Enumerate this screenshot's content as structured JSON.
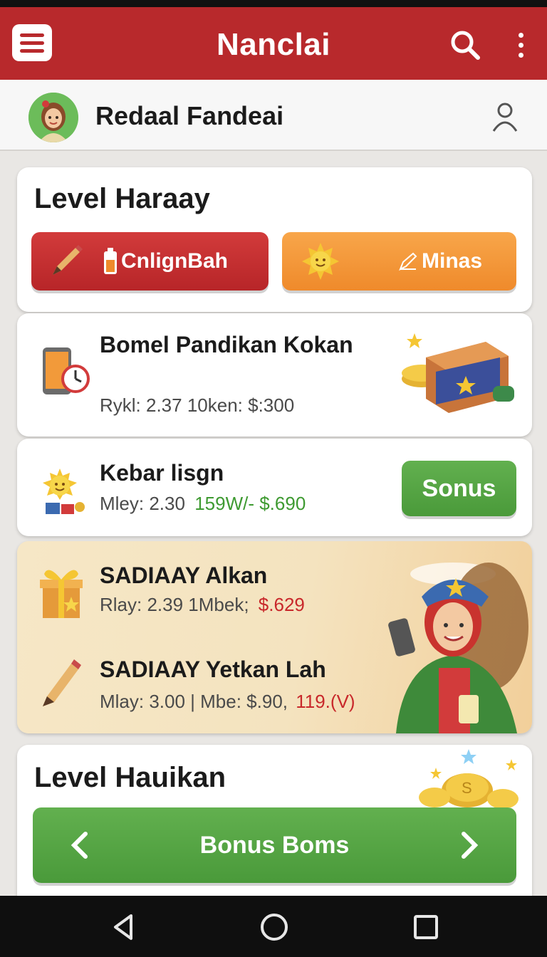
{
  "app": {
    "title": "Nanclai"
  },
  "profile": {
    "name": "Redaal Fandeai"
  },
  "level_card": {
    "title": "Level Haraay",
    "left_button": "CnlignBah",
    "right_button": "Minas"
  },
  "items": [
    {
      "title": "Bomel Pandikan Kokan",
      "sub": "Rykl: 2.37  10ken: $:300"
    },
    {
      "title": "Kebar lisgn",
      "sub_left": "Mley: 2.30",
      "sub_right": "159W/- $.690",
      "button": "Sonus"
    }
  ],
  "promo": {
    "row1": {
      "title": "SADIAAY Alkan",
      "sub_left": "Rlay: 2.39  1Mbek;",
      "sub_right": "$.629"
    },
    "row2": {
      "title": "SADIAAY Yetkan Lah",
      "sub_left": "Mlay: 3.00 | Mbe: $.90,",
      "sub_right": "119.(V)"
    }
  },
  "bottom_card": {
    "title": "Level Hauikan",
    "bonus_button": "Bonus Boms"
  },
  "colors": {
    "primary": "#b8292c",
    "accent_orange": "#ef8a2b",
    "accent_green": "#4f9e3e"
  },
  "icons": {
    "menu": "menu-icon",
    "search": "search-icon",
    "more": "more-vert-icon",
    "user": "user-icon",
    "back": "nav-back-icon",
    "home": "nav-home-icon",
    "recents": "nav-recents-icon"
  }
}
